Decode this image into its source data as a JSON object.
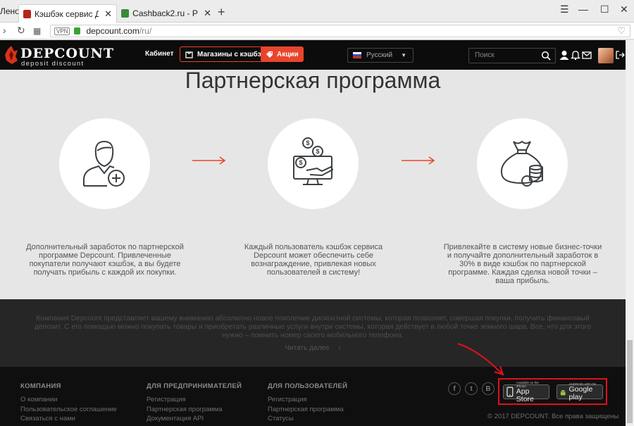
{
  "browser": {
    "partial_tab_label": "Лено",
    "tabs": [
      {
        "label": "Кэшбэк сервис Дэпкаунт",
        "close": "✕"
      },
      {
        "label": "Cashback2.ru - Рейтинг л",
        "close": "✕"
      }
    ],
    "new_tab": "+",
    "url_host": "depcount.com",
    "url_path": "/ru/",
    "vpn_badge": "VPN"
  },
  "header": {
    "logo_title": "DEPCOUNT",
    "logo_subtitle": "deposit discount",
    "nav_cabinet": "Кабинет",
    "nav_shops": "Магазины с кэшбэк",
    "nav_promo": "Акции",
    "language": "Русский",
    "search_placeholder": "Поиск",
    "accent_color": "#e8452c"
  },
  "main": {
    "title": "Партнерская программа",
    "steps": [
      {
        "icon": "user-add-icon",
        "text": "Дополнительный заработок по партнерской программе Depcount. Привлеченные покупатели получают кэшбэк, а вы будете получать прибыль с каждой их покупки."
      },
      {
        "icon": "money-monitor-icon",
        "text": "Каждый пользователь кэшбэк сервиса Depcount может обеспечить себе вознаграждение, привлекая новых пользователей в систему!"
      },
      {
        "icon": "money-bag-icon",
        "text": "Привлекайте в систему новые бизнес-точки и получайте дополнительный заработок в 30% в виде кэшбэк по партнерской программе. Каждая сделка новой точки – ваша прибыль."
      }
    ]
  },
  "info": {
    "text": "Компания Depcount представляет вашему вниманию абсолютно новое поколение дисконтной системы, которая позволяет, совершая покупки, получить финансовый депозит. С его помощью можно покупать товары и приобретать различные услуги внутри системы, которая действует в любой точке земного шара. Все, что для этого нужно – помнить номер своего мобильного телефона.",
    "read_more": "Читать далее"
  },
  "footer": {
    "columns": [
      {
        "title": "КОМПАНИЯ",
        "links": [
          "О компании",
          "Пользовательское соглашение",
          "Связаться с нами"
        ]
      },
      {
        "title": "ДЛЯ ПРЕДПРИНИМАТЕЛЕЙ",
        "links": [
          "Регистрация",
          "Партнерская программа",
          "Документация API"
        ]
      },
      {
        "title": "ДЛЯ ПОЛЬЗОВАТЕЛЕЙ",
        "links": [
          "Регистрация",
          "Партнерская программа",
          "Статусы"
        ]
      }
    ],
    "social": {
      "facebook": "f",
      "twitter": "t",
      "vk": "В",
      "odnoklassniki": "о"
    },
    "app_store": {
      "small": "Available on the iPhone",
      "big": "App Store"
    },
    "google_play": {
      "small": "ANDROID APP ON",
      "big": "Google play"
    },
    "copyright": "© 2017 DEPCOUNT. Все права защищены",
    "highlight_color": "#e0101e"
  }
}
